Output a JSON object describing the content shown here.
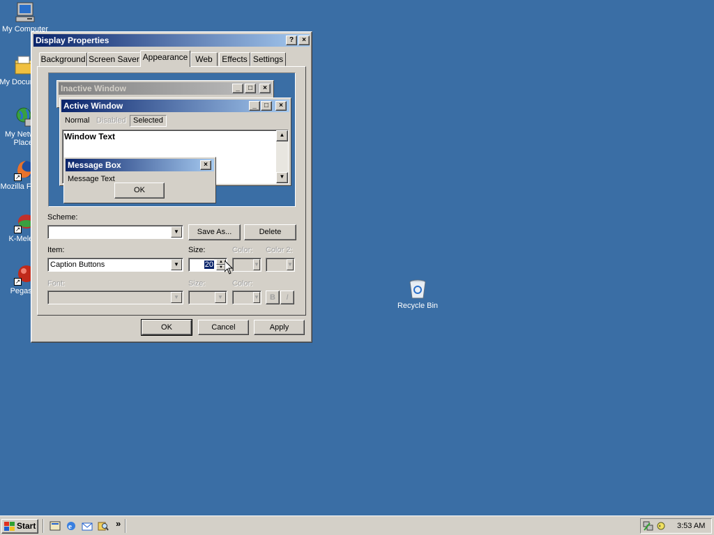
{
  "desktop": {
    "icons": [
      {
        "label": "My Computer"
      },
      {
        "label": "My Documents"
      },
      {
        "label": "My Network Places"
      },
      {
        "label": "Mozilla Firefox"
      },
      {
        "label": "K-Meleon"
      },
      {
        "label": "Pegasus"
      },
      {
        "label": "Recycle Bin"
      }
    ]
  },
  "dialog": {
    "title": "Display Properties",
    "help_glyph": "?",
    "close_glyph": "×",
    "tabs": [
      "Background",
      "Screen Saver",
      "Appearance",
      "Web",
      "Effects",
      "Settings"
    ],
    "active_tab": "Appearance",
    "preview": {
      "inactive_title": "Inactive Window",
      "active_title": "Active Window",
      "menu": {
        "normal": "Normal",
        "disabled": "Disabled",
        "selected": "Selected"
      },
      "window_text": "Window Text",
      "msgbox_title": "Message Box",
      "msgbox_text": "Message Text",
      "msgbox_ok": "OK"
    },
    "scheme_label": "Scheme:",
    "scheme_value": "",
    "save_as_label": "Save As...",
    "delete_label": "Delete",
    "item_label": "Item:",
    "item_value": "Caption Buttons",
    "size_label": "Size:",
    "size_value": "20",
    "color_label": "Color:",
    "color2_label": "Color 2:",
    "font_label": "Font:",
    "font_size_label": "Size:",
    "font_color_label": "Color:",
    "bold_label": "B",
    "italic_label": "I",
    "ok_label": "OK",
    "cancel_label": "Cancel",
    "apply_label": "Apply"
  },
  "taskbar": {
    "start_label": "Start",
    "chevron": "»",
    "clock": "3:53 AM"
  },
  "colors": {
    "desktop": "#3a6ea5",
    "active_title_start": "#0a246a",
    "active_title_end": "#a6caf0",
    "inactive_title_start": "#808080",
    "inactive_title_end": "#c0c0c0",
    "face": "#d4d0c8",
    "selected": "#0a246a"
  }
}
